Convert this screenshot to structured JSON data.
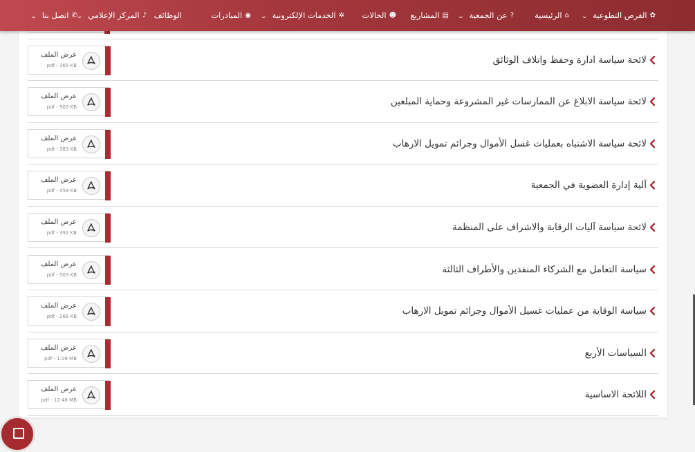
{
  "nav": {
    "items": [
      {
        "label": "الفرص التطوعية",
        "icon": "volunteer-icon",
        "dropdown": true
      },
      {
        "label": "الرئيسية",
        "icon": "home-icon",
        "dropdown": false
      },
      {
        "label": "عن الجمعية",
        "icon": "question-icon",
        "dropdown": true
      },
      {
        "label": "المشاريع",
        "icon": "projects-icon",
        "dropdown": false
      },
      {
        "label": "الحالات",
        "icon": "cases-icon",
        "dropdown": false
      },
      {
        "label": "الخدمات الإلكترونية",
        "icon": "eservices-icon",
        "dropdown": true
      },
      {
        "label": "المبادرات",
        "icon": "initiatives-icon",
        "dropdown": false
      },
      {
        "label": "الوظائف",
        "icon": "",
        "dropdown": false
      },
      {
        "label": "المركز الإعلامي",
        "icon": "microphone-icon",
        "dropdown": true
      },
      {
        "label": "اتصل بنا",
        "icon": "phone-icon",
        "dropdown": true
      }
    ]
  },
  "documents": [
    {
      "title": "لائحة سياسة ادارة وحفظ واتلاف الوثائق",
      "view_label": "عرض الملف",
      "meta": "pdf - 365 KB"
    },
    {
      "title": "لائحة سياسة الابلاغ عن الممارسات غير المشروعة وحماية المبلغين",
      "view_label": "عرض الملف",
      "meta": "pdf - 903 KB"
    },
    {
      "title": "لائحة سياسة الاشتباه بعمليات غسل الأموال وجرائم تمويل الارهاب",
      "view_label": "عرض الملف",
      "meta": "pdf - 383 KB"
    },
    {
      "title": "آلية إدارة العضوية في الجمعية",
      "view_label": "عرض الملف",
      "meta": "pdf - 459 KB"
    },
    {
      "title": "لائحة سياسة آليات الرقابة والاشراف على المنظمة",
      "view_label": "عرض الملف",
      "meta": "pdf - 392 KB"
    },
    {
      "title": "سياسة التعامل مع الشركاء المنفذين والأطراف الثالثة",
      "view_label": "عرض الملف",
      "meta": "pdf - 503 KB"
    },
    {
      "title": "سياسة الوقاية من عمليات غسيل الأموال وجرائم تمويل الارهاب",
      "view_label": "عرض الملف",
      "meta": "pdf - 266 KB"
    },
    {
      "title": "السياسات الأربع",
      "view_label": "عرض الملف",
      "meta": "pdf - 1.08 MB"
    },
    {
      "title": "اللائحة الاساسية",
      "view_label": "عرض الملف",
      "meta": "pdf - 12.46 MB"
    }
  ],
  "colors": {
    "brand": "#a82d33",
    "text": "#333333"
  }
}
